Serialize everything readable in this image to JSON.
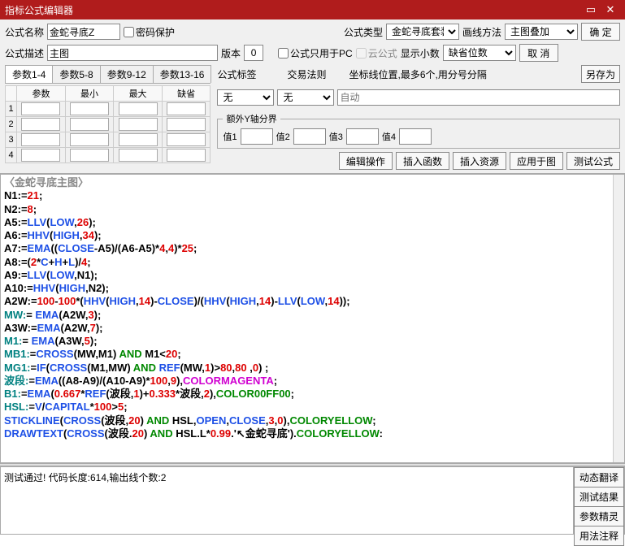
{
  "titlebar": {
    "title": "指标公式编辑器"
  },
  "labels": {
    "formula_name": "公式名称",
    "password_protect": "密码保护",
    "formula_type": "公式类型",
    "draw_method": "画线方法",
    "ok": "确 定",
    "formula_desc": "公式描述",
    "version": "版本",
    "pc_only": "公式只用于PC",
    "cloud_formula": "云公式",
    "show_decimal": "显示小数",
    "cancel": "取 消",
    "save_as": "另存为",
    "formula_tag": "公式标签",
    "trade_rule": "交易法则",
    "coord_pos": "坐标线位置,最多6个,用分号分隔",
    "auto": "自动",
    "extra_yaxis": "额外Y轴分界",
    "val1": "值1",
    "val2": "值2",
    "val3": "值3",
    "val4": "值4",
    "edit_op": "编辑操作",
    "insert_func": "插入函数",
    "insert_res": "插入资源",
    "apply_fig": "应用于图",
    "test_formula": "测试公式",
    "none": "无",
    "decimal_default": "缺省位数"
  },
  "formula": {
    "name": "金蛇寻底Z",
    "type_value": "金蛇寻底套装",
    "draw_value": "主图叠加",
    "desc": "主图",
    "version": "0"
  },
  "param_tabs": [
    "参数1-4",
    "参数5-8",
    "参数9-12",
    "参数13-16"
  ],
  "param_headers": [
    "",
    "参数",
    "最小",
    "最大",
    "缺省"
  ],
  "param_rows": [
    "1",
    "2",
    "3",
    "4"
  ],
  "code": {
    "title_open": "〈",
    "title_text": "金蛇寻底主图",
    "title_close": "〉",
    "lines": [
      [
        [
          "c-black",
          "N1:="
        ],
        [
          "c-red",
          "21"
        ],
        [
          "c-black",
          ";"
        ]
      ],
      [
        [
          "c-black",
          "N2:="
        ],
        [
          "c-red",
          "8"
        ],
        [
          "c-black",
          ";"
        ]
      ],
      [
        [
          "c-black",
          "A5:="
        ],
        [
          "c-blue",
          "LLV"
        ],
        [
          "c-black",
          "("
        ],
        [
          "c-blue",
          "LOW"
        ],
        [
          "c-black",
          ","
        ],
        [
          "c-red",
          "26"
        ],
        [
          "c-black",
          ");"
        ]
      ],
      [
        [
          "c-black",
          "A6:="
        ],
        [
          "c-blue",
          "HHV"
        ],
        [
          "c-black",
          "("
        ],
        [
          "c-blue",
          "HIGH"
        ],
        [
          "c-black",
          ","
        ],
        [
          "c-red",
          "34"
        ],
        [
          "c-black",
          ");"
        ]
      ],
      [
        [
          "c-black",
          "A7:="
        ],
        [
          "c-blue",
          "EMA"
        ],
        [
          "c-black",
          "(("
        ],
        [
          "c-blue",
          "CLOSE"
        ],
        [
          "c-black",
          "-A5)/(A6-A5)*"
        ],
        [
          "c-red",
          "4"
        ],
        [
          "c-black",
          ","
        ],
        [
          "c-red",
          "4"
        ],
        [
          "c-black",
          ")*"
        ],
        [
          "c-red",
          "25"
        ],
        [
          "c-black",
          ";"
        ]
      ],
      [
        [
          "c-black",
          "A8:=("
        ],
        [
          "c-red",
          "2"
        ],
        [
          "c-black",
          "*"
        ],
        [
          "c-blue",
          "C"
        ],
        [
          "c-black",
          "+"
        ],
        [
          "c-blue",
          "H"
        ],
        [
          "c-black",
          "+"
        ],
        [
          "c-blue",
          "L"
        ],
        [
          "c-black",
          ")/"
        ],
        [
          "c-red",
          "4"
        ],
        [
          "c-black",
          ";"
        ]
      ],
      [
        [
          "c-black",
          "A9:="
        ],
        [
          "c-blue",
          "LLV"
        ],
        [
          "c-black",
          "("
        ],
        [
          "c-blue",
          "LOW"
        ],
        [
          "c-black",
          ",N1);"
        ]
      ],
      [
        [
          "c-black",
          "A10:="
        ],
        [
          "c-blue",
          "HHV"
        ],
        [
          "c-black",
          "("
        ],
        [
          "c-blue",
          "HIGH"
        ],
        [
          "c-black",
          ",N2);"
        ]
      ],
      [
        [
          "c-black",
          "A2W:="
        ],
        [
          "c-red",
          "100"
        ],
        [
          "c-black",
          "-"
        ],
        [
          "c-red",
          "100"
        ],
        [
          "c-black",
          "*("
        ],
        [
          "c-blue",
          "HHV"
        ],
        [
          "c-black",
          "("
        ],
        [
          "c-blue",
          "HIGH"
        ],
        [
          "c-black",
          ","
        ],
        [
          "c-red",
          "14"
        ],
        [
          "c-black",
          ")-"
        ],
        [
          "c-blue",
          "CLOSE"
        ],
        [
          "c-black",
          ")/("
        ],
        [
          "c-blue",
          "HHV"
        ],
        [
          "c-black",
          "("
        ],
        [
          "c-blue",
          "HIGH"
        ],
        [
          "c-black",
          ","
        ],
        [
          "c-red",
          "14"
        ],
        [
          "c-black",
          ")-"
        ],
        [
          "c-blue",
          "LLV"
        ],
        [
          "c-black",
          "("
        ],
        [
          "c-blue",
          "LOW"
        ],
        [
          "c-black",
          ","
        ],
        [
          "c-red",
          "14"
        ],
        [
          "c-black",
          "));"
        ]
      ],
      [
        [
          "c-darkcyan",
          "MW:"
        ],
        [
          "c-black",
          "= "
        ],
        [
          "c-blue",
          "EMA"
        ],
        [
          "c-black",
          "(A2W,"
        ],
        [
          "c-red",
          "3"
        ],
        [
          "c-black",
          ");"
        ]
      ],
      [
        [
          "c-black",
          "A3W:="
        ],
        [
          "c-blue",
          "EMA"
        ],
        [
          "c-black",
          "(A2W,"
        ],
        [
          "c-red",
          "7"
        ],
        [
          "c-black",
          ");"
        ]
      ],
      [
        [
          "c-darkcyan",
          "M1:"
        ],
        [
          "c-black",
          "= "
        ],
        [
          "c-blue",
          "EMA"
        ],
        [
          "c-black",
          "(A3W,"
        ],
        [
          "c-red",
          "5"
        ],
        [
          "c-black",
          ");"
        ]
      ],
      [
        [
          "c-darkcyan",
          "MB1:"
        ],
        [
          "c-black",
          "="
        ],
        [
          "c-blue",
          "CROSS"
        ],
        [
          "c-black",
          "(MW,M1) "
        ],
        [
          "c-green",
          "AND"
        ],
        [
          "c-black",
          " M1<"
        ],
        [
          "c-red",
          "20"
        ],
        [
          "c-black",
          ";"
        ]
      ],
      [
        [
          "c-darkcyan",
          "MG1:"
        ],
        [
          "c-black",
          "="
        ],
        [
          "c-blue",
          "IF"
        ],
        [
          "c-black",
          "("
        ],
        [
          "c-blue",
          "CROSS"
        ],
        [
          "c-black",
          "(M1,MW) "
        ],
        [
          "c-green",
          "AND"
        ],
        [
          "c-black",
          " "
        ],
        [
          "c-blue",
          "REF"
        ],
        [
          "c-black",
          "(MW,"
        ],
        [
          "c-red",
          "1"
        ],
        [
          "c-black",
          ")>"
        ],
        [
          "c-red",
          "80"
        ],
        [
          "c-black",
          ","
        ],
        [
          "c-red",
          "80"
        ],
        [
          "c-black",
          " ,"
        ],
        [
          "c-red",
          "0"
        ],
        [
          "c-black",
          ") ;"
        ]
      ],
      [
        [
          "c-darkcyan",
          "波段:"
        ],
        [
          "c-black",
          "="
        ],
        [
          "c-blue",
          "EMA"
        ],
        [
          "c-black",
          "((A8-A9)/(A10-A9)*"
        ],
        [
          "c-red",
          "100"
        ],
        [
          "c-black",
          ","
        ],
        [
          "c-red",
          "9"
        ],
        [
          "c-black",
          "),"
        ],
        [
          "c-magenta",
          "COLORMAGENTA"
        ],
        [
          "c-black",
          ";"
        ]
      ],
      [
        [
          "c-darkcyan",
          "B1:"
        ],
        [
          "c-black",
          "="
        ],
        [
          "c-blue",
          "EMA"
        ],
        [
          "c-black",
          "("
        ],
        [
          "c-red",
          "0.667"
        ],
        [
          "c-black",
          "*"
        ],
        [
          "c-blue",
          "REF"
        ],
        [
          "c-black",
          "(波段,"
        ],
        [
          "c-red",
          "1"
        ],
        [
          "c-black",
          ")+"
        ],
        [
          "c-red",
          "0.333"
        ],
        [
          "c-black",
          "*波段,"
        ],
        [
          "c-red",
          "2"
        ],
        [
          "c-black",
          "),"
        ],
        [
          "c-green",
          "COLOR00FF00"
        ],
        [
          "c-black",
          ";"
        ]
      ],
      [
        [
          "c-darkcyan",
          "HSL:"
        ],
        [
          "c-black",
          "="
        ],
        [
          "c-blue",
          "V"
        ],
        [
          "c-black",
          "/"
        ],
        [
          "c-blue",
          "CAPITAL"
        ],
        [
          "c-black",
          "*"
        ],
        [
          "c-red",
          "100"
        ],
        [
          "c-black",
          ">"
        ],
        [
          "c-red",
          "5"
        ],
        [
          "c-black",
          ";"
        ]
      ],
      [
        [
          "c-blue",
          "STICKLINE"
        ],
        [
          "c-black",
          "("
        ],
        [
          "c-blue",
          "CROSS"
        ],
        [
          "c-black",
          "(波段,"
        ],
        [
          "c-red",
          "20"
        ],
        [
          "c-black",
          ") "
        ],
        [
          "c-green",
          "AND"
        ],
        [
          "c-black",
          " HSL,"
        ],
        [
          "c-blue",
          "OPEN"
        ],
        [
          "c-black",
          ","
        ],
        [
          "c-blue",
          "CLOSE"
        ],
        [
          "c-black",
          ","
        ],
        [
          "c-red",
          "3"
        ],
        [
          "c-black",
          ","
        ],
        [
          "c-red",
          "0"
        ],
        [
          "c-black",
          "),"
        ],
        [
          "c-green",
          "COLORYELLOW"
        ],
        [
          "c-black",
          ";"
        ]
      ],
      [
        [
          "c-blue",
          "DRAWTEXT"
        ],
        [
          "c-black",
          "("
        ],
        [
          "c-blue",
          "CROSS"
        ],
        [
          "c-black",
          "(波段."
        ],
        [
          "c-red",
          "20"
        ],
        [
          "c-black",
          ") "
        ],
        [
          "c-green",
          "AND"
        ],
        [
          "c-black",
          " HSL.L*"
        ],
        [
          "c-red",
          "0.99"
        ],
        [
          "c-black",
          ".'↖金蛇寻底')."
        ],
        [
          "c-green",
          "COLORYELLOW"
        ],
        [
          "c-black",
          ":"
        ]
      ]
    ]
  },
  "output": {
    "text": "测试通过! 代码长度:614,输出线个数:2"
  },
  "side_btns": [
    "动态翻译",
    "测试结果",
    "参数精灵",
    "用法注释"
  ]
}
